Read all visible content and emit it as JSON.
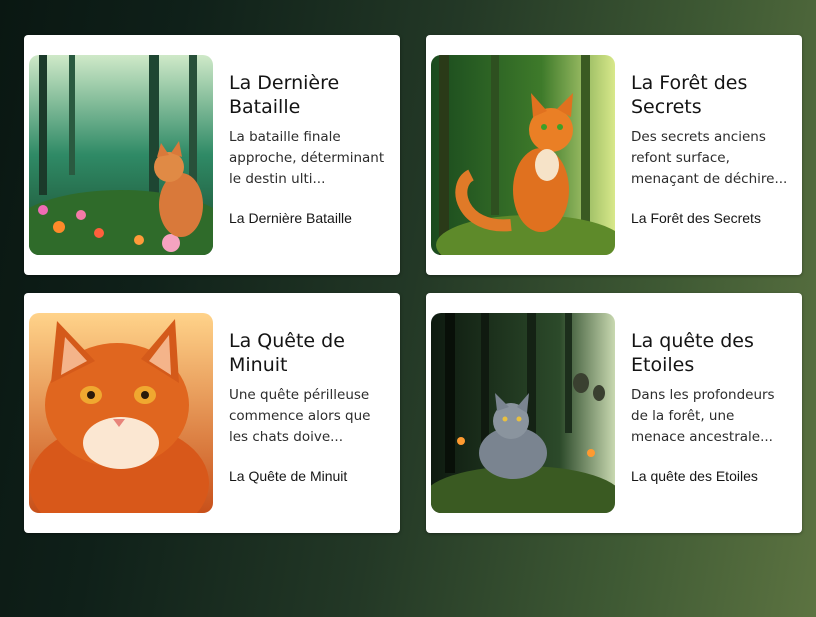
{
  "cards": [
    {
      "title": "La Dernière Bataille",
      "description": "La bataille finale approche, déterminant le destin ulti...",
      "link_text": "La Dernière Bataille",
      "image_icon": "ginger-cat-forest-flowers"
    },
    {
      "title": "La Forêt des Secrets",
      "description": "Des secrets anciens refont surface, menaçant de déchire...",
      "link_text": "La Forêt des Secrets",
      "image_icon": "orange-cat-on-mossy-rock"
    },
    {
      "title": "La Quête de Minuit",
      "description": "Une quête périlleuse commence alors que les chats doive...",
      "link_text": "La Quête de Minuit",
      "image_icon": "orange-cat-portrait"
    },
    {
      "title": "La quête des Etoiles",
      "description": "Dans les profondeurs de la forêt, une menace ancestrale...",
      "link_text": "La quête des Etoiles",
      "image_icon": "grey-cat-dark-forest"
    }
  ],
  "colors": {
    "card_background": "#ffffff",
    "page_gradient_start": "#0a1712",
    "page_gradient_end": "#5c7341"
  }
}
